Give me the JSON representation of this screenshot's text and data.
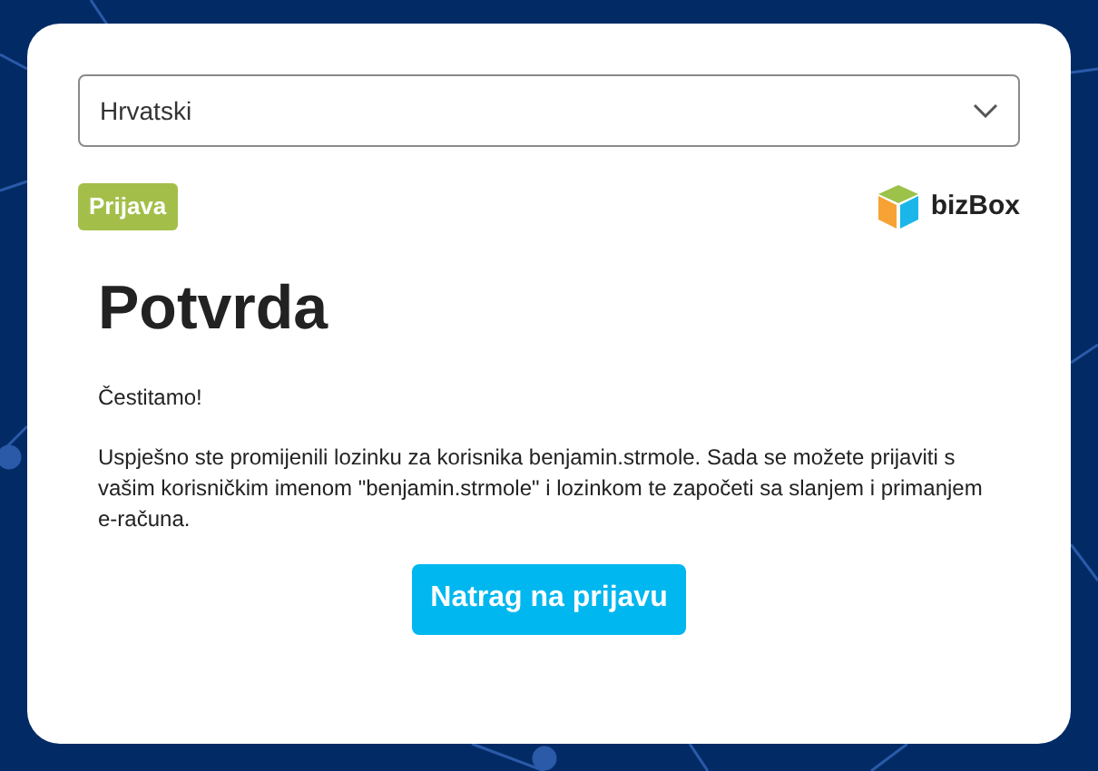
{
  "language_select": {
    "value": "Hrvatski"
  },
  "badge": "Prijava",
  "logo": {
    "text": "bizBox"
  },
  "title": "Potvrda",
  "greeting": "Čestitamo!",
  "message": "Uspješno ste promijenili lozinku za korisnika benjamin.strmole. Sada se možete prijaviti s vašim korisničkim imenom \"benjamin.strmole\" i lozinkom te započeti sa slanjem i primanjem e-računa.",
  "button": "Natrag na prijavu"
}
